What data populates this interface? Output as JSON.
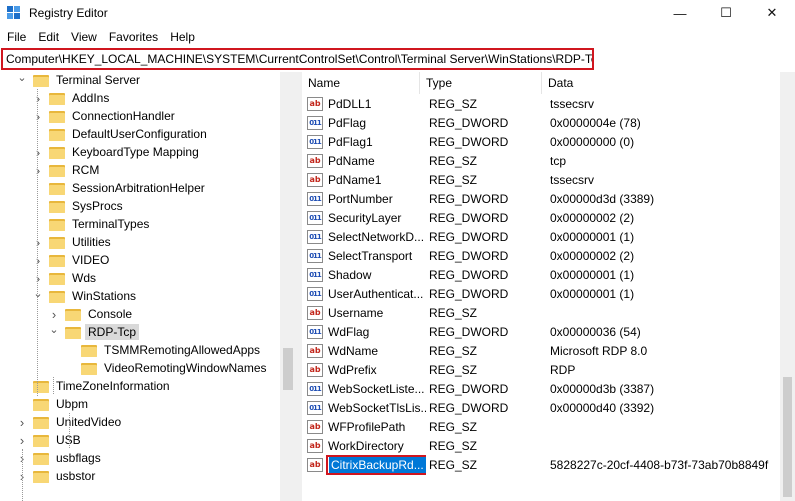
{
  "window": {
    "title": "Registry Editor",
    "controls": {
      "minimize": "—",
      "maximize": "☐",
      "close": "✕"
    }
  },
  "menu": [
    "File",
    "Edit",
    "View",
    "Favorites",
    "Help"
  ],
  "address": "Computer\\HKEY_LOCAL_MACHINE\\SYSTEM\\CurrentControlSet\\Control\\Terminal Server\\WinStations\\RDP-Tcp",
  "tree": [
    {
      "label": "Terminal Server",
      "depth": 0,
      "expand": "open"
    },
    {
      "label": "AddIns",
      "depth": 1,
      "expand": "closed"
    },
    {
      "label": "ConnectionHandler",
      "depth": 1,
      "expand": "closed"
    },
    {
      "label": "DefaultUserConfiguration",
      "depth": 1,
      "expand": "none"
    },
    {
      "label": "KeyboardType Mapping",
      "depth": 1,
      "expand": "closed"
    },
    {
      "label": "RCM",
      "depth": 1,
      "expand": "closed"
    },
    {
      "label": "SessionArbitrationHelper",
      "depth": 1,
      "expand": "none"
    },
    {
      "label": "SysProcs",
      "depth": 1,
      "expand": "none"
    },
    {
      "label": "TerminalTypes",
      "depth": 1,
      "expand": "none"
    },
    {
      "label": "Utilities",
      "depth": 1,
      "expand": "closed"
    },
    {
      "label": "VIDEO",
      "depth": 1,
      "expand": "closed"
    },
    {
      "label": "Wds",
      "depth": 1,
      "expand": "closed"
    },
    {
      "label": "WinStations",
      "depth": 1,
      "expand": "open"
    },
    {
      "label": "Console",
      "depth": 2,
      "expand": "closed"
    },
    {
      "label": "RDP-Tcp",
      "depth": 2,
      "expand": "open",
      "selected": true
    },
    {
      "label": "TSMMRemotingAllowedApps",
      "depth": 3,
      "expand": "none"
    },
    {
      "label": "VideoRemotingWindowNames",
      "depth": 3,
      "expand": "none"
    },
    {
      "label": "TimeZoneInformation",
      "depth": 0,
      "expand": "none"
    },
    {
      "label": "Ubpm",
      "depth": 0,
      "expand": "none"
    },
    {
      "label": "UnitedVideo",
      "depth": 0,
      "expand": "closed"
    },
    {
      "label": "USB",
      "depth": 0,
      "expand": "closed"
    },
    {
      "label": "usbflags",
      "depth": 0,
      "expand": "closed"
    },
    {
      "label": "usbstor",
      "depth": 0,
      "expand": "closed"
    }
  ],
  "columns": {
    "name": "Name",
    "type": "Type",
    "data": "Data"
  },
  "values": [
    {
      "name": "PdDLL1",
      "type": "REG_SZ",
      "data": "tssecsrv",
      "icon": "string"
    },
    {
      "name": "PdFlag",
      "type": "REG_DWORD",
      "data": "0x0000004e (78)",
      "icon": "binary"
    },
    {
      "name": "PdFlag1",
      "type": "REG_DWORD",
      "data": "0x00000000 (0)",
      "icon": "binary"
    },
    {
      "name": "PdName",
      "type": "REG_SZ",
      "data": "tcp",
      "icon": "string"
    },
    {
      "name": "PdName1",
      "type": "REG_SZ",
      "data": "tssecsrv",
      "icon": "string"
    },
    {
      "name": "PortNumber",
      "type": "REG_DWORD",
      "data": "0x00000d3d (3389)",
      "icon": "binary"
    },
    {
      "name": "SecurityLayer",
      "type": "REG_DWORD",
      "data": "0x00000002 (2)",
      "icon": "binary"
    },
    {
      "name": "SelectNetworkD...",
      "type": "REG_DWORD",
      "data": "0x00000001 (1)",
      "icon": "binary"
    },
    {
      "name": "SelectTransport",
      "type": "REG_DWORD",
      "data": "0x00000002 (2)",
      "icon": "binary"
    },
    {
      "name": "Shadow",
      "type": "REG_DWORD",
      "data": "0x00000001 (1)",
      "icon": "binary"
    },
    {
      "name": "UserAuthenticat...",
      "type": "REG_DWORD",
      "data": "0x00000001 (1)",
      "icon": "binary"
    },
    {
      "name": "Username",
      "type": "REG_SZ",
      "data": "",
      "icon": "string"
    },
    {
      "name": "WdFlag",
      "type": "REG_DWORD",
      "data": "0x00000036 (54)",
      "icon": "binary"
    },
    {
      "name": "WdName",
      "type": "REG_SZ",
      "data": "Microsoft RDP 8.0",
      "icon": "string"
    },
    {
      "name": "WdPrefix",
      "type": "REG_SZ",
      "data": "RDP",
      "icon": "string"
    },
    {
      "name": "WebSocketListe...",
      "type": "REG_DWORD",
      "data": "0x00000d3b (3387)",
      "icon": "binary"
    },
    {
      "name": "WebSocketTlsLis...",
      "type": "REG_DWORD",
      "data": "0x00000d40 (3392)",
      "icon": "binary"
    },
    {
      "name": "WFProfilePath",
      "type": "REG_SZ",
      "data": "",
      "icon": "string"
    },
    {
      "name": "WorkDirectory",
      "type": "REG_SZ",
      "data": "",
      "icon": "string"
    },
    {
      "name": "CitrixBackupRd...",
      "type": "REG_SZ",
      "data": "5828227c-20cf-4408-b73f-73ab70b8849f",
      "icon": "string",
      "selected": true
    }
  ],
  "icon_glyphs": {
    "string": "ab",
    "binary": "011"
  },
  "colors": {
    "highlight_border": "#d0161f",
    "selection": "#0078d7",
    "folder": "#f8d775"
  }
}
